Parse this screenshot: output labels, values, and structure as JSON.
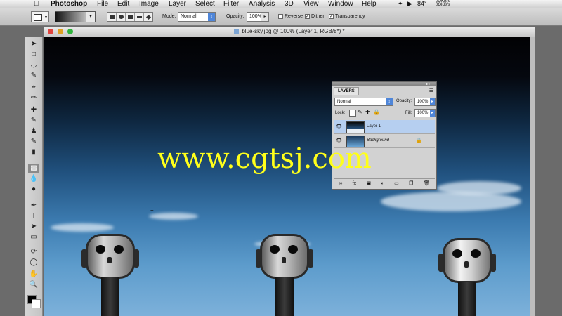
{
  "menubar": {
    "app": "Photoshop",
    "items": [
      "File",
      "Edit",
      "Image",
      "Layer",
      "Select",
      "Filter",
      "Analysis",
      "3D",
      "View",
      "Window",
      "Help"
    ],
    "status": {
      "temperature": "84°",
      "net_up": "0OKB/s",
      "net_down": "0OKB/s"
    }
  },
  "options_bar": {
    "mode_label": "Mode:",
    "mode_value": "Normal",
    "opacity_label": "Opacity:",
    "opacity_value": "100%",
    "reverse_label": "Reverse",
    "reverse_checked": false,
    "dither_label": "Dither",
    "dither_checked": true,
    "transparency_label": "Transparency",
    "transparency_checked": true
  },
  "document": {
    "title": "blue-sky.jpg @ 100% (Layer 1, RGB/8*) *"
  },
  "layers_panel": {
    "tab": "LAYERS",
    "blend_mode": "Normal",
    "opacity_label": "Opacity:",
    "opacity_value": "100%",
    "lock_label": "Lock:",
    "fill_label": "Fill:",
    "fill_value": "100%",
    "layers": [
      {
        "name": "Layer 1",
        "selected": true,
        "locked": false
      },
      {
        "name": "Background",
        "selected": false,
        "locked": true
      }
    ]
  },
  "watermark": "www.cgtsj.com",
  "colors": {
    "accent": "#4f86d9",
    "watermark": "#ffff1a",
    "selected_layer": "#b6cff0"
  }
}
